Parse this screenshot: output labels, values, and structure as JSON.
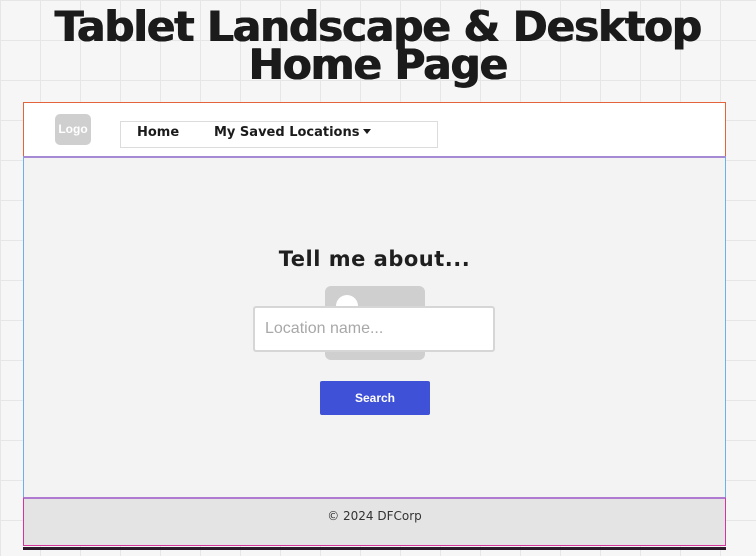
{
  "page": {
    "title_line1": "Tablet Landscape & Desktop",
    "title_line2": "Home Page"
  },
  "header": {
    "logo_label": "Logo",
    "nav": {
      "home_label": "Home",
      "saved_locations_label": "My Saved Locations"
    }
  },
  "main": {
    "heading": "Tell me about...",
    "search": {
      "placeholder": "Location name...",
      "value": "",
      "button_label": "Search"
    }
  },
  "footer": {
    "copyright": "©  2024 DFCorp"
  },
  "icons": {
    "dropdown": "chevron-down-icon",
    "image_placeholder": "image-icon"
  },
  "colors": {
    "accent": "#3f51d6",
    "header_outline": "#e3643a",
    "main_outline": "#6bb1e8",
    "footer_outline": "#d4359a"
  }
}
